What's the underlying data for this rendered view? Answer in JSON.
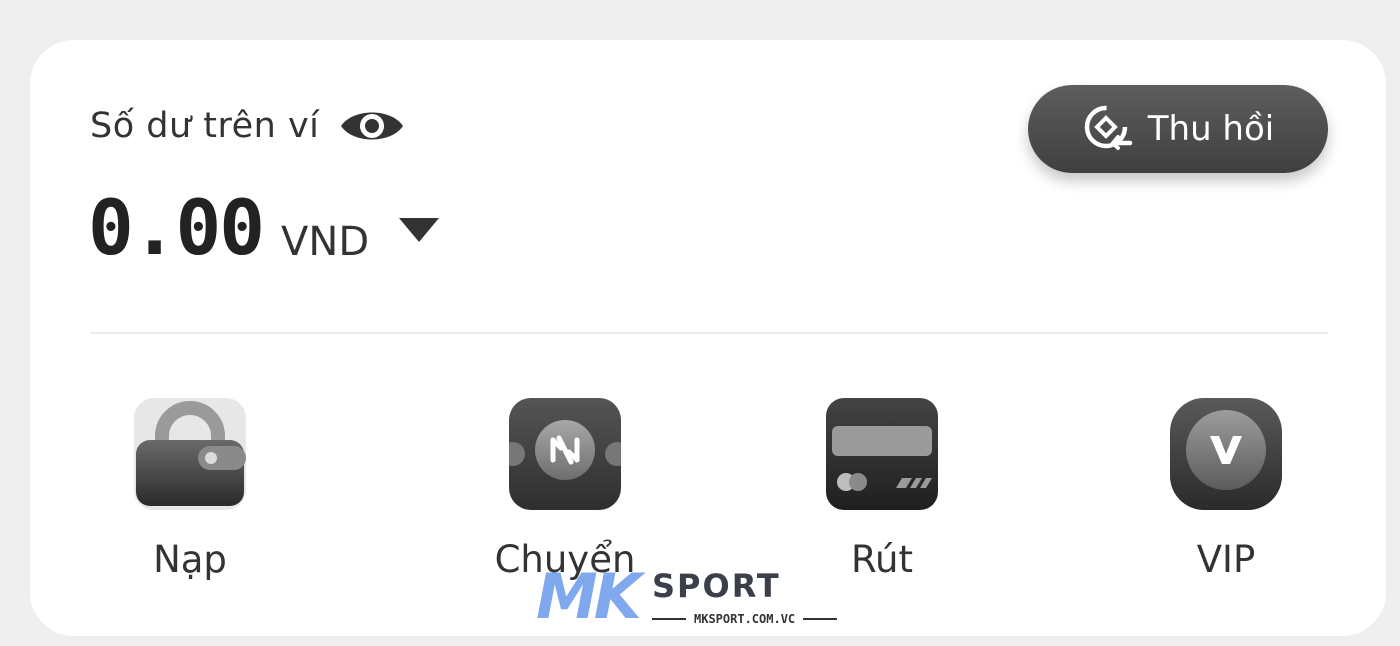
{
  "wallet": {
    "balance_label": "Số dư trên ví",
    "amount": "0.00",
    "currency": "VND",
    "visibility_icon": "eye-icon",
    "currency_dropdown_icon": "caret-down-icon"
  },
  "recall_button": {
    "label": "Thu hồi",
    "icon": "recall-icon"
  },
  "actions": [
    {
      "label": "Nạp",
      "icon": "wallet-deposit-icon"
    },
    {
      "label": "Chuyển",
      "icon": "transfer-icon"
    },
    {
      "label": "Rút",
      "icon": "withdraw-card-icon"
    },
    {
      "label": "VIP",
      "icon": "vip-badge-icon"
    }
  ],
  "watermark": {
    "logo": "MK",
    "brand": "SPORT",
    "domain": "MKSPORT.COM.VC"
  },
  "colors": {
    "background": "#efefef",
    "card": "#ffffff",
    "button": "#4a4a4a",
    "watermark_accent": "#7fa8ef"
  }
}
